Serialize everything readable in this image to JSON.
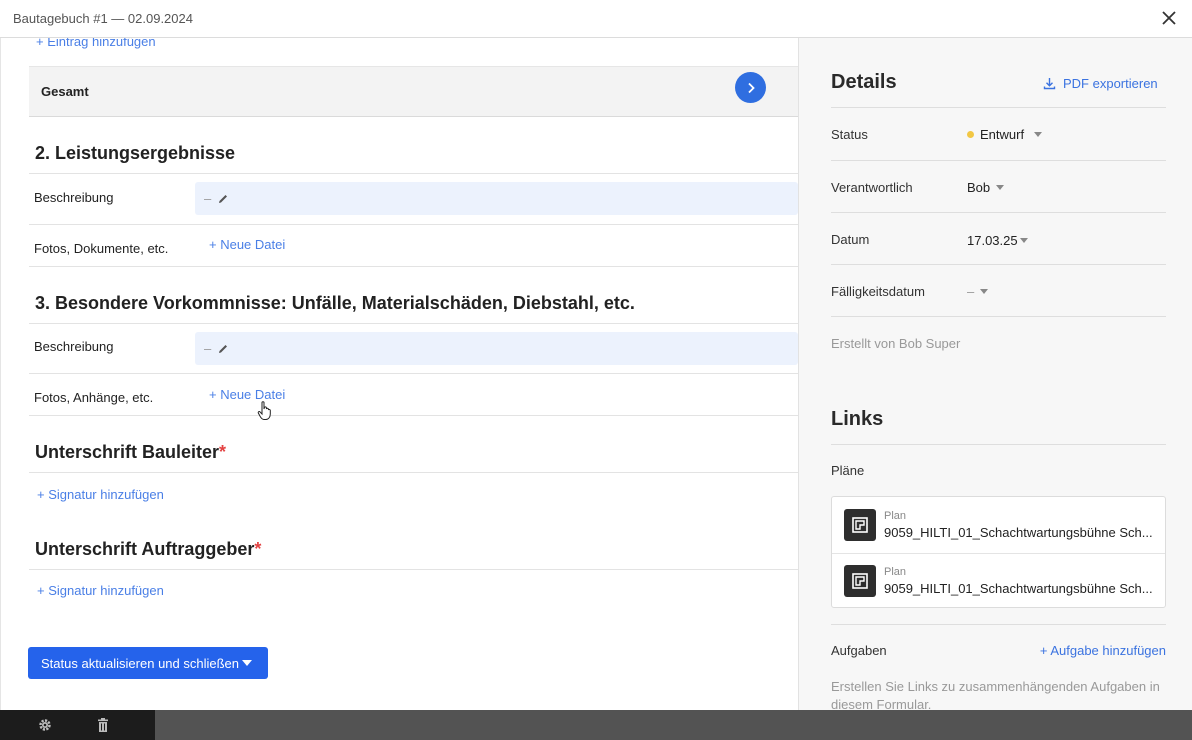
{
  "window": {
    "title": "Bautagebuch #1 — 02.09.2024"
  },
  "main": {
    "add_entry_link": "+ Eintrag hinzufügen",
    "total_label": "Gesamt",
    "section2": {
      "title": "2. Leistungsergebnisse",
      "desc_label": "Beschreibung",
      "desc_value": "–",
      "files_label": "Fotos, Dokumente, etc.",
      "new_file": "+ Neue Datei"
    },
    "section3": {
      "title": "3. Besondere Vorkommnisse: Unfälle, Materialschäden, Diebstahl, etc.",
      "desc_label": "Beschreibung",
      "desc_value": "–",
      "files_label": "Fotos, Anhänge, etc.",
      "new_file": "+ Neue Datei"
    },
    "sig_site": {
      "title": "Unterschrift Bauleiter",
      "required": "*",
      "add": "+ Signatur hinzufügen"
    },
    "sig_client": {
      "title": "Unterschrift Auftraggeber",
      "required": "*",
      "add": "+ Signatur hinzufügen"
    },
    "submit_button": "Status aktualisieren und schließen"
  },
  "sidebar": {
    "details_title": "Details",
    "export_pdf": "PDF exportieren",
    "status_label": "Status",
    "status_value": "Entwurf",
    "status_color": "#f2c744",
    "responsible_label": "Verantwortlich",
    "responsible_value": "Bob",
    "date_label": "Datum",
    "date_value": "17.03.25",
    "due_label": "Fälligkeitsdatum",
    "due_value": "–",
    "created_by": "Erstellt von Bob Super",
    "links_title": "Links",
    "plans_label": "Pläne",
    "plans": [
      {
        "type": "Plan",
        "name": "9059_HILTI_01_Schachtwartungsbühne Sch..."
      },
      {
        "type": "Plan",
        "name": "9059_HILTI_01_Schachtwartungsbühne Sch..."
      }
    ],
    "tasks_label": "Aufgaben",
    "add_task": "+ Aufgabe hinzufügen",
    "tasks_hint": "Erstellen Sie Links zu zusammenhängenden Aufgaben in diesem Formular."
  },
  "bottom_bar": {
    "icons": [
      "gear-icon",
      "trash-icon"
    ]
  },
  "colors": {
    "accent": "#2563eb",
    "link": "#4a7fe6"
  }
}
